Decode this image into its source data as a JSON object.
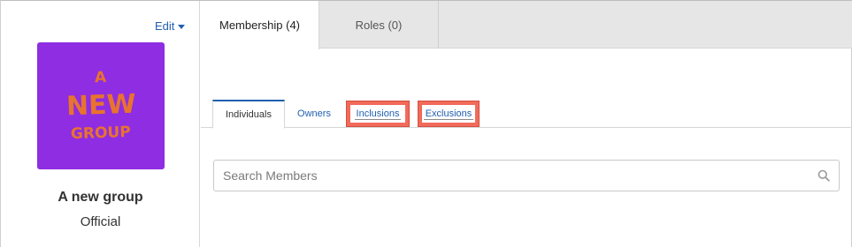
{
  "group": {
    "edit_label": "Edit",
    "avatar_lines": [
      "A",
      "NEW",
      "GROUP"
    ],
    "name": "A new group",
    "type": "Official"
  },
  "top_tabs": [
    {
      "label": "Membership (4)",
      "active": true
    },
    {
      "label": "Roles (0)",
      "active": false
    }
  ],
  "sub_tabs": [
    {
      "label": "Individuals",
      "active": true
    },
    {
      "label": "Owners",
      "active": false
    },
    {
      "label": "Inclusions",
      "active": false,
      "highlighted": true
    },
    {
      "label": "Exclusions",
      "active": false,
      "highlighted": true
    }
  ],
  "search": {
    "placeholder": "Search Members",
    "value": ""
  },
  "colors": {
    "link": "#1f5fb0",
    "avatar_bg": "#8e2de2",
    "avatar_text": "#e8732e",
    "highlight": "#f26a5a",
    "tab_bar_bg": "#e6e6e6"
  },
  "icons": {
    "edit_caret": "caret-down-icon",
    "search": "search-icon"
  }
}
